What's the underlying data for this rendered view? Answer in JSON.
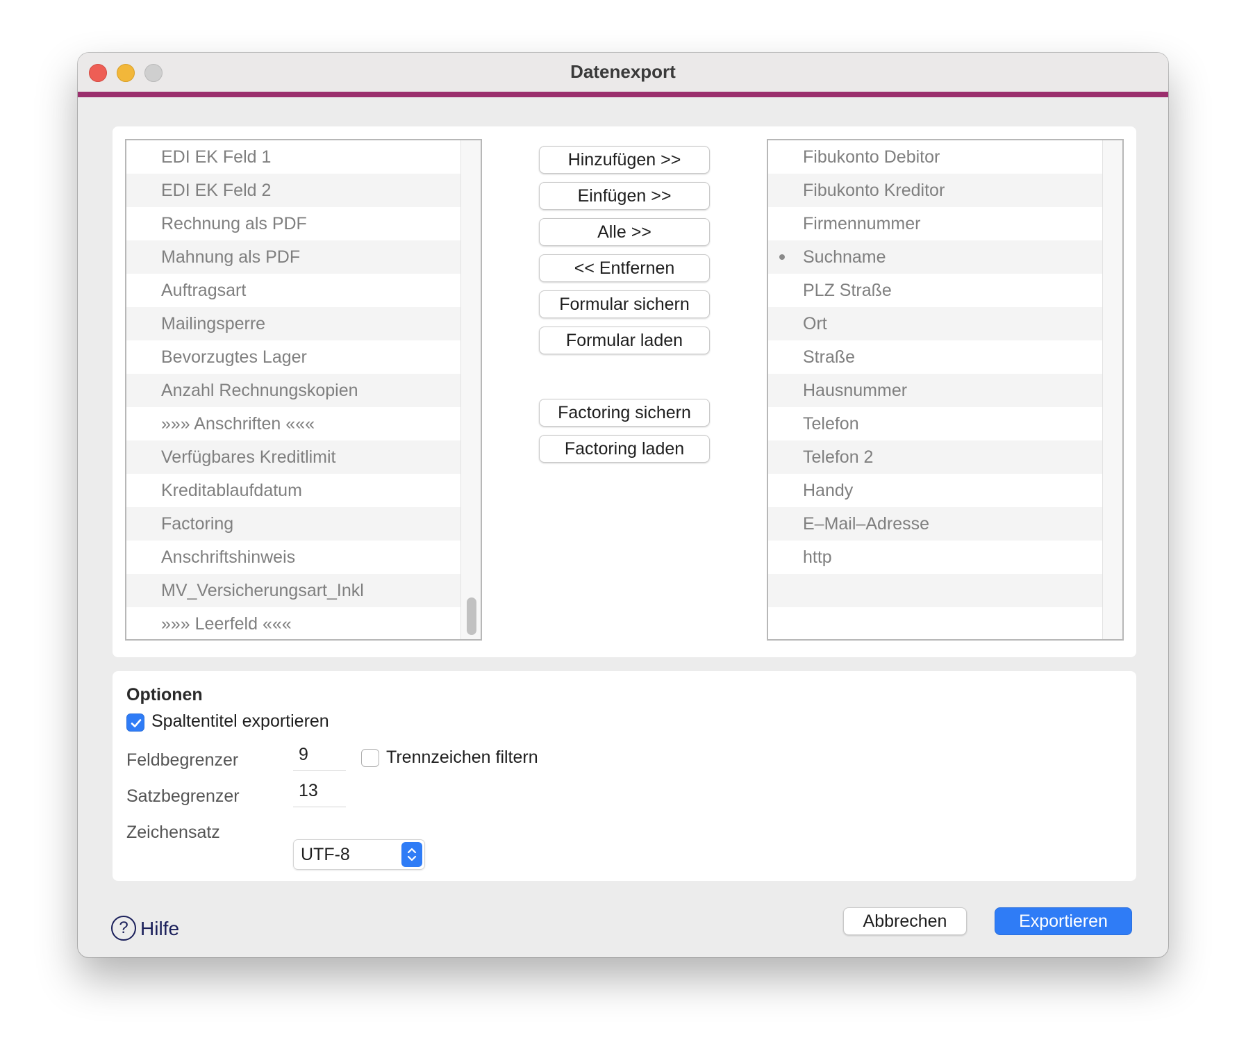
{
  "window": {
    "title": "Datenexport"
  },
  "colors": {
    "accent_bar": "#9b2f6d",
    "primary_button": "#2f7cf6",
    "help_text": "#1a1f5a"
  },
  "available_fields": [
    "EDI EK Feld 1",
    "EDI EK Feld 2",
    "Rechnung als PDF",
    "Mahnung als PDF",
    "Auftragsart",
    "Mailingsperre",
    "Bevorzugtes Lager",
    "Anzahl Rechnungskopien",
    "»»» Anschriften «««",
    "Verfügbares Kreditlimit",
    "Kreditablaufdatum",
    "Factoring",
    "Anschriftshinweis",
    "MV_Versicherungsart_Inkl",
    "»»» Leerfeld «««"
  ],
  "selected_fields": [
    "Fibukonto Debitor",
    "Fibukonto Kreditor",
    "Firmennummer",
    "Suchname",
    "PLZ Straße",
    "Ort",
    "Straße",
    "Hausnummer",
    "Telefon",
    "Telefon 2",
    "Handy",
    "E–Mail–Adresse",
    "http"
  ],
  "selected_fields_bullet_index": 3,
  "actions": {
    "add": "Hinzufügen >>",
    "insert": "Einfügen >>",
    "all": "Alle >>",
    "remove": "<< Entfernen",
    "save_form": "Formular sichern",
    "load_form": "Formular laden",
    "save_factoring": "Factoring sichern",
    "load_factoring": "Factoring laden"
  },
  "options": {
    "heading": "Optionen",
    "export_column_titles": {
      "label": "Spaltentitel exportieren",
      "checked": true
    },
    "field_delimiter": {
      "label": "Feldbegrenzer",
      "value": "9"
    },
    "filter_separators": {
      "label": "Trennzeichen filtern",
      "checked": false
    },
    "record_delimiter": {
      "label": "Satzbegrenzer",
      "value": "13"
    },
    "charset": {
      "label": "Zeichensatz",
      "value": "UTF-8"
    }
  },
  "footer": {
    "help_label": "Hilfe",
    "help_icon_glyph": "?",
    "cancel_label": "Abbrechen",
    "export_label": "Exportieren"
  }
}
